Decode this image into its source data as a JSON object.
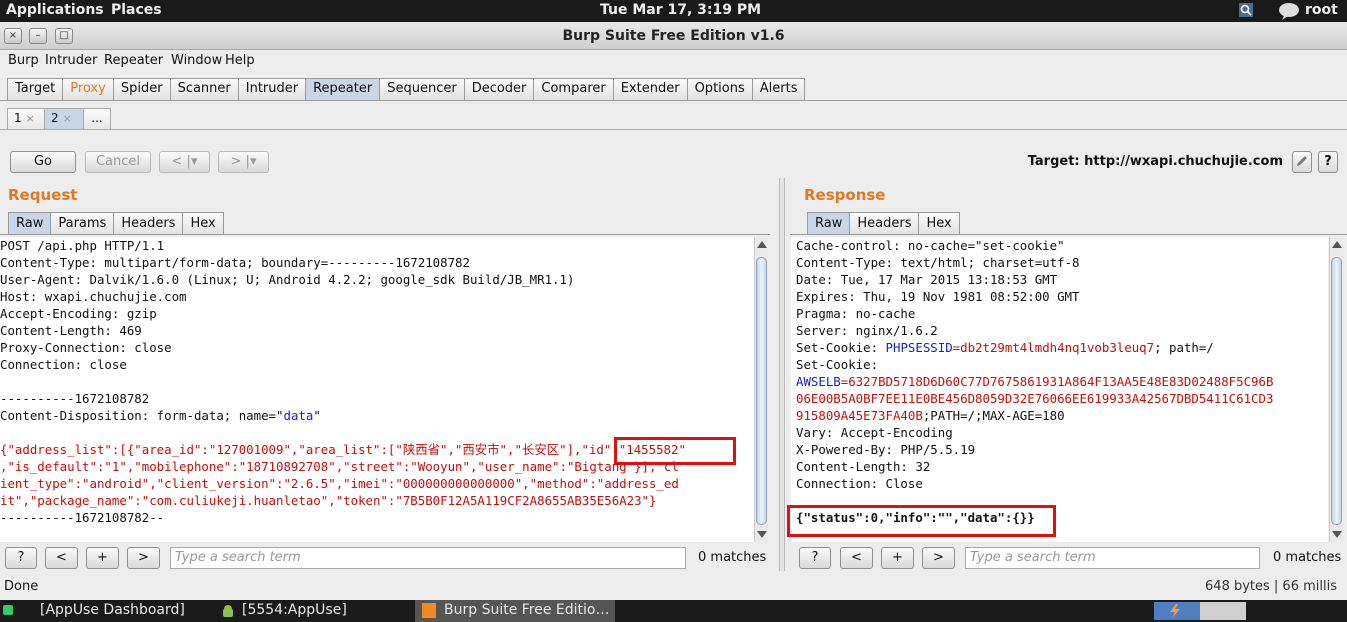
{
  "top_panel": {
    "applications": "Applications",
    "places": "Places",
    "clock": "Tue Mar 17,  3:19 PM",
    "user": "root"
  },
  "window": {
    "title": "Burp Suite Free Edition v1.6",
    "close": "×",
    "minimize": "–",
    "maximize": "□"
  },
  "menu": [
    "Burp",
    "Intruder",
    "Repeater",
    "Window",
    "Help"
  ],
  "main_tabs": [
    "Target",
    "Proxy",
    "Spider",
    "Scanner",
    "Intruder",
    "Repeater",
    "Sequencer",
    "Decoder",
    "Comparer",
    "Extender",
    "Options",
    "Alerts"
  ],
  "main_tabs_selected": "Repeater",
  "sub_tabs": [
    {
      "label": "1",
      "close": "×"
    },
    {
      "label": "2",
      "close": "×"
    },
    {
      "label": "...",
      "close": ""
    }
  ],
  "controls": {
    "go": "Go",
    "cancel": "Cancel",
    "back": "<",
    "forward": ">",
    "dropdown": "▾",
    "target": "Target: http://wxapi.chuchujie.com",
    "edit_icon": "pencil-icon",
    "help": "?"
  },
  "request": {
    "title": "Request",
    "tabs": [
      "Raw",
      "Params",
      "Headers",
      "Hex"
    ],
    "lines": [
      [
        {
          "t": "POST /api.php HTTP/1.1"
        }
      ],
      [
        {
          "t": "Content-Type: multipart/form-data; boundary=---------1672108782"
        }
      ],
      [
        {
          "t": "User-Agent: Dalvik/1.6.0 (Linux; U; Android 4.2.2; google_sdk Build/JB_MR1.1)"
        }
      ],
      [
        {
          "t": "Host: wxapi.chuchujie.com"
        }
      ],
      [
        {
          "t": "Accept-Encoding: gzip"
        }
      ],
      [
        {
          "t": "Content-Length: 469"
        }
      ],
      [
        {
          "t": "Proxy-Connection: close"
        }
      ],
      [
        {
          "t": "Connection: close"
        }
      ],
      [
        {
          "t": ""
        }
      ],
      [
        {
          "t": "----------1672108782"
        }
      ],
      [
        {
          "t": "Content-Disposition: form-data; name=\""
        },
        {
          "t": "data",
          "c": "blue"
        },
        {
          "t": "\""
        }
      ],
      [
        {
          "t": ""
        }
      ],
      [
        {
          "t": "{\"address_list\":[{\"area_id\":\"127001009\",\"area_list\":[\"陕西省\",\"西安市\",\"长安区\"],\"id\":\"1455582\"",
          "c": "red"
        }
      ],
      [
        {
          "t": ",\"is_default\":\"1\",\"mobilephone\":\"18710892708\",\"street\":\"Wooyun\",\"user_name\":\"Bigtang\"}],\"cl",
          "c": "red"
        }
      ],
      [
        {
          "t": "ient_type\":\"android\",\"client_version\":\"2.6.5\",\"imei\":\"000000000000000\",\"method\":\"address_ed",
          "c": "red"
        }
      ],
      [
        {
          "t": "it\",\"package_name\":\"com.culiukeji.huanletao\",\"token\":\"7B5B0F12A5A119CF2A8655AB35E56A23\"}",
          "c": "red"
        }
      ],
      [
        {
          "t": "----------1672108782--"
        }
      ]
    ]
  },
  "response": {
    "title": "Response",
    "tabs": [
      "Raw",
      "Headers",
      "Hex"
    ],
    "lines": [
      [
        {
          "t": "Cache-control: no-cache=\"set-cookie\""
        }
      ],
      [
        {
          "t": "Content-Type: text/html; charset=utf-8"
        }
      ],
      [
        {
          "t": "Date: Tue, 17 Mar 2015 13:18:53 GMT"
        }
      ],
      [
        {
          "t": "Expires: Thu, 19 Nov 1981 08:52:00 GMT"
        }
      ],
      [
        {
          "t": "Pragma: no-cache"
        }
      ],
      [
        {
          "t": "Server: nginx/1.6.2"
        }
      ],
      [
        {
          "t": "Set-Cookie: "
        },
        {
          "t": "PHPSESSID",
          "c": "blue"
        },
        {
          "t": "=db2t29mt4lmdh4nq1vob3leuq7",
          "c": "red"
        },
        {
          "t": "; path=/"
        }
      ],
      [
        {
          "t": "Set-Cookie:"
        }
      ],
      [
        {
          "t": "AWSELB",
          "c": "blue"
        },
        {
          "t": "=6327BD5718D6D60C77D7675861931A864F13AA5E48E83D02488F5C96B",
          "c": "red"
        }
      ],
      [
        {
          "t": "06E00B5A0BF7EE11E0BE456D8059D32E76066EE619933A42567DBD5411C61CD3",
          "c": "red"
        }
      ],
      [
        {
          "t": "915809A45E73FA40B",
          "c": "red"
        },
        {
          "t": ";PATH=/;MAX-AGE=180"
        }
      ],
      [
        {
          "t": "Vary: Accept-Encoding"
        }
      ],
      [
        {
          "t": "X-Powered-By: PHP/5.5.19"
        }
      ],
      [
        {
          "t": "Content-Length: 32"
        }
      ],
      [
        {
          "t": "Connection: Close"
        }
      ],
      [
        {
          "t": ""
        }
      ],
      [
        {
          "t": "{\"status\":0,\"info\":\"\",\"data\":{}}"
        }
      ]
    ]
  },
  "search": {
    "help": "?",
    "prev": "<",
    "add": "+",
    "next": ">",
    "placeholder": "Type a search term",
    "matches": "0 matches"
  },
  "status": {
    "left": "Done",
    "right": "648 bytes | 66 millis"
  },
  "taskbar": [
    {
      "label": "[AppUse Dashboard]",
      "icon": "terminal-icon"
    },
    {
      "label": "[5554:AppUse]",
      "icon": "android-icon"
    },
    {
      "label": "Burp Suite Free Editio…",
      "icon": "burp-icon"
    }
  ]
}
